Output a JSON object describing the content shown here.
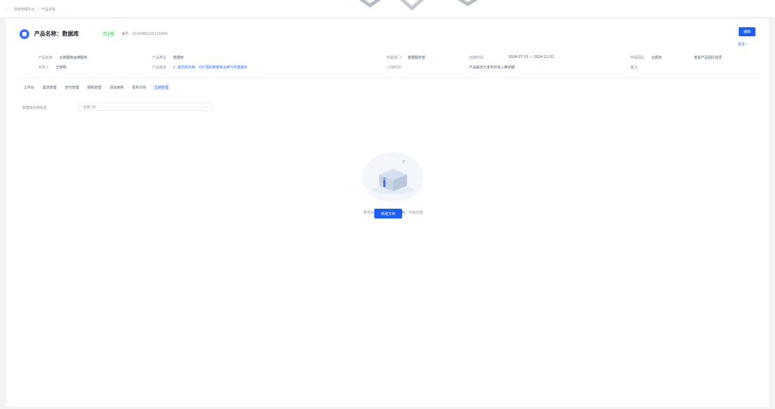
{
  "topbar": {
    "back_label": "‹",
    "breadcrumb": [
      "项目管理平台",
      "产品详情"
    ]
  },
  "header": {
    "title": "产品名称：数据库",
    "status": "已上线",
    "product_id": "编号：2024080100123456",
    "edit_label": "编辑",
    "more_label": "更多 ›"
  },
  "info": {
    "col1": [
      {
        "k": "产品名称",
        "v": "云数据库运维服务"
      },
      {
        "k": "负责人",
        "v": "王晓明"
      }
    ],
    "col2": [
      {
        "k": "产品类型",
        "v": "数据库"
      },
      {
        "k": "产品描述",
        "v": "1. 提供高可用、可扩展的数据库运维与管理服务"
      }
    ],
    "col3": [
      {
        "k": "所属部门",
        "v": "数据服务部"
      },
      {
        "k": "上线时间",
        "v": ""
      }
    ],
    "col4": [
      {
        "k": "创建时间",
        "v": "2024-07-01 ~ 2024-12-31"
      },
      {
        "k": "",
        "v": "产品版本已发布并进入维护期"
      }
    ],
    "col5": [
      {
        "k": "所属团队",
        "v": "云服务"
      },
      {
        "k": "备注",
        "v": ""
      }
    ],
    "col6": {
      "v": "查看产品团队成员"
    }
  },
  "tabs": [
    "工作台",
    "需求管理",
    "迭代管理",
    "缺陷管理",
    "测试用例",
    "发布计划",
    "文档管理"
  ],
  "active_tab": 6,
  "filter": {
    "label": "数据库实例状态",
    "value": "全部 (0)",
    "chevron": "⌄"
  },
  "empty": {
    "text": "暂无内容，请添加新的文档，开始记录",
    "button_label": "新建文档"
  },
  "colors": {
    "accent": "#1e5ef0",
    "status": "#00b42a"
  },
  "icons": {
    "header": "database-icon",
    "empty": "empty-box-illustration"
  }
}
